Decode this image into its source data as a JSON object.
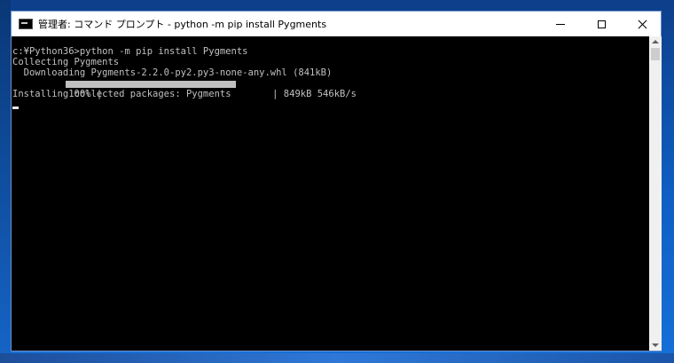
{
  "window": {
    "title": "管理者: コマンド プロンプト - python  -m pip install Pygments",
    "controls": {
      "minimize": "minimize-icon",
      "maximize": "maximize-icon",
      "close": "close-icon"
    }
  },
  "console": {
    "lines": [
      "c:¥Python36>python -m pip install Pygments",
      "Collecting Pygments",
      "  Downloading Pygments-2.2.0-py2.py3-none-any.whl (841kB)",
      "Installing collected packages: Pygments"
    ],
    "progress": {
      "percent_label": "    100% |",
      "fraction": 1.0,
      "tail": "| 849kB 546kB/s"
    }
  },
  "colors": {
    "console_bg": "#000000",
    "console_text": "#c0c0c0",
    "desktop": "#0f5fc4"
  }
}
